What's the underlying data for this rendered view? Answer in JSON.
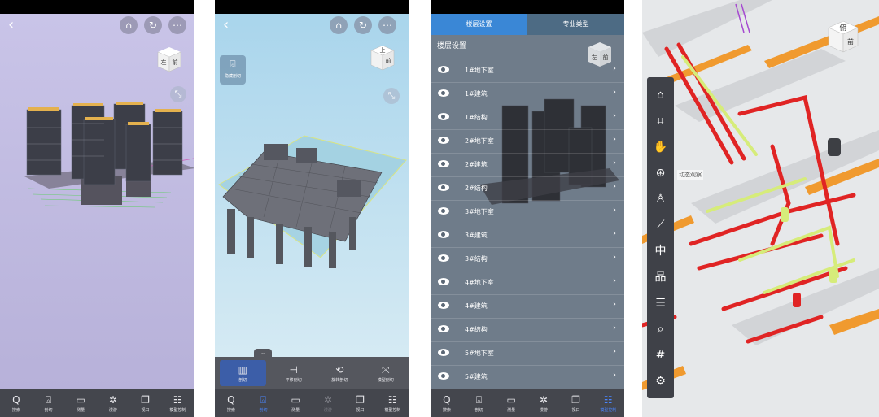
{
  "screen1": {
    "cube": {
      "left": "左",
      "front": "前"
    },
    "tabs": [
      {
        "icon": "Q",
        "label": "搜索"
      },
      {
        "icon": "⌺",
        "label": "剖切"
      },
      {
        "icon": "▭",
        "label": "测量"
      },
      {
        "icon": "✲",
        "label": "漫游"
      },
      {
        "icon": "❐",
        "label": "视口"
      },
      {
        "icon": "☷",
        "label": "模型控制"
      }
    ]
  },
  "screen2": {
    "cube": {
      "top": "上",
      "front": "前"
    },
    "section_button": "隐藏剖切",
    "subtools": [
      {
        "icon": "▥",
        "label": "剖切"
      },
      {
        "icon": "⊣",
        "label": "平移剖切"
      },
      {
        "icon": "⟲",
        "label": "旋转剖切"
      },
      {
        "icon": "⤧",
        "label": "模型剖切"
      }
    ],
    "tabs": [
      {
        "icon": "Q",
        "label": "搜索"
      },
      {
        "icon": "⌺",
        "label": "剖切"
      },
      {
        "icon": "▭",
        "label": "测量"
      },
      {
        "icon": "✲",
        "label": "漫游"
      },
      {
        "icon": "❐",
        "label": "视口"
      },
      {
        "icon": "☷",
        "label": "模型控制"
      }
    ]
  },
  "screen3": {
    "tab_floor": "楼层设置",
    "tab_type": "专业类型",
    "panel_title": "楼层设置",
    "cube": {
      "left": "左",
      "front": "前"
    },
    "floors": [
      "1#地下室",
      "1#建筑",
      "1#结构",
      "2#地下室",
      "2#建筑",
      "2#结构",
      "3#地下室",
      "3#建筑",
      "3#结构",
      "4#地下室",
      "4#建筑",
      "4#结构",
      "5#地下室",
      "5#建筑"
    ],
    "tabs": [
      {
        "icon": "Q",
        "label": "搜索"
      },
      {
        "icon": "⌺",
        "label": "剖切"
      },
      {
        "icon": "▭",
        "label": "测量"
      },
      {
        "icon": "✲",
        "label": "漫游"
      },
      {
        "icon": "❐",
        "label": "视口"
      },
      {
        "icon": "☷",
        "label": "模型控制"
      }
    ]
  },
  "screen4": {
    "cube": {
      "top": "俯",
      "front": "前"
    },
    "tooltip": "动态观察",
    "tools": [
      "⌂",
      "⌗",
      "✋",
      "⊛",
      "♙",
      "⟋",
      "中",
      "品",
      "☰",
      "⌕",
      "#",
      "⚙"
    ]
  }
}
